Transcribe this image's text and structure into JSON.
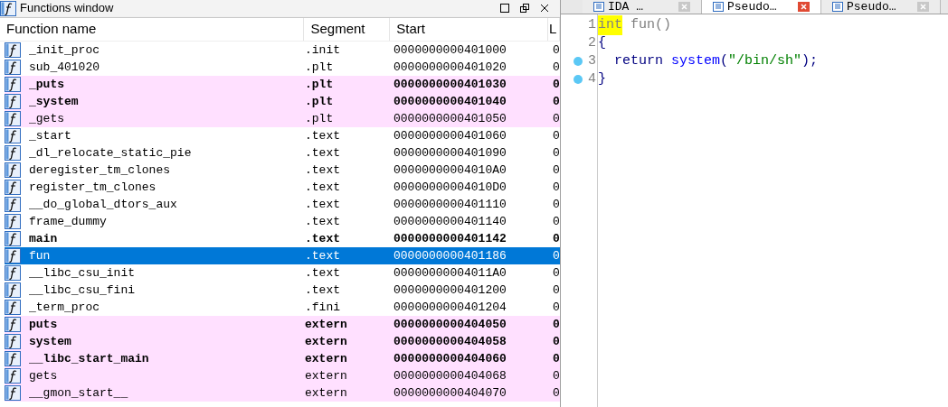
{
  "functions_window": {
    "title": "Functions window",
    "columns": [
      "Function name",
      "Segment",
      "Start",
      "L"
    ],
    "rows": [
      {
        "name": "_init_proc",
        "segment": ".init",
        "start": "0000000000401000",
        "column_4": "0",
        "bold": false,
        "highlighted": false,
        "selected": false
      },
      {
        "name": "sub_401020",
        "segment": ".plt",
        "start": "0000000000401020",
        "column_4": "0",
        "bold": false,
        "highlighted": false,
        "selected": false
      },
      {
        "name": "_puts",
        "segment": ".plt",
        "start": "0000000000401030",
        "column_4": "0",
        "bold": true,
        "highlighted": true,
        "selected": false
      },
      {
        "name": "_system",
        "segment": ".plt",
        "start": "0000000000401040",
        "column_4": "0",
        "bold": true,
        "highlighted": true,
        "selected": false
      },
      {
        "name": "_gets",
        "segment": ".plt",
        "start": "0000000000401050",
        "column_4": "0",
        "bold": false,
        "highlighted": true,
        "selected": false
      },
      {
        "name": "_start",
        "segment": ".text",
        "start": "0000000000401060",
        "column_4": "0",
        "bold": false,
        "highlighted": false,
        "selected": false
      },
      {
        "name": "_dl_relocate_static_pie",
        "segment": ".text",
        "start": "0000000000401090",
        "column_4": "0",
        "bold": false,
        "highlighted": false,
        "selected": false
      },
      {
        "name": "deregister_tm_clones",
        "segment": ".text",
        "start": "00000000004010A0",
        "column_4": "0",
        "bold": false,
        "highlighted": false,
        "selected": false
      },
      {
        "name": "register_tm_clones",
        "segment": ".text",
        "start": "00000000004010D0",
        "column_4": "0",
        "bold": false,
        "highlighted": false,
        "selected": false
      },
      {
        "name": "__do_global_dtors_aux",
        "segment": ".text",
        "start": "0000000000401110",
        "column_4": "0",
        "bold": false,
        "highlighted": false,
        "selected": false
      },
      {
        "name": "frame_dummy",
        "segment": ".text",
        "start": "0000000000401140",
        "column_4": "0",
        "bold": false,
        "highlighted": false,
        "selected": false
      },
      {
        "name": "main",
        "segment": ".text",
        "start": "0000000000401142",
        "column_4": "0",
        "bold": true,
        "highlighted": false,
        "selected": false
      },
      {
        "name": "fun",
        "segment": ".text",
        "start": "0000000000401186",
        "column_4": "0",
        "bold": false,
        "highlighted": false,
        "selected": true
      },
      {
        "name": "__libc_csu_init",
        "segment": ".text",
        "start": "00000000004011A0",
        "column_4": "0",
        "bold": false,
        "highlighted": false,
        "selected": false
      },
      {
        "name": "__libc_csu_fini",
        "segment": ".text",
        "start": "0000000000401200",
        "column_4": "0",
        "bold": false,
        "highlighted": false,
        "selected": false
      },
      {
        "name": "_term_proc",
        "segment": ".fini",
        "start": "0000000000401204",
        "column_4": "0",
        "bold": false,
        "highlighted": false,
        "selected": false
      },
      {
        "name": "puts",
        "segment": "extern",
        "start": "0000000000404050",
        "column_4": "0",
        "bold": true,
        "highlighted": true,
        "selected": false
      },
      {
        "name": "system",
        "segment": "extern",
        "start": "0000000000404058",
        "column_4": "0",
        "bold": true,
        "highlighted": true,
        "selected": false
      },
      {
        "name": "__libc_start_main",
        "segment": "extern",
        "start": "0000000000404060",
        "column_4": "0",
        "bold": true,
        "highlighted": true,
        "selected": false
      },
      {
        "name": "gets",
        "segment": "extern",
        "start": "0000000000404068",
        "column_4": "0",
        "bold": false,
        "highlighted": true,
        "selected": false
      },
      {
        "name": "__gmon_start__",
        "segment": "extern",
        "start": "0000000000404070",
        "column_4": "0",
        "bold": false,
        "highlighted": true,
        "selected": false
      }
    ]
  },
  "tabs": [
    {
      "label": "IDA …",
      "selected": false
    },
    {
      "label": "Pseudo…",
      "selected": true
    },
    {
      "label": "Pseudo…",
      "selected": false
    }
  ],
  "code": [
    {
      "number": "1",
      "breakpoint": false,
      "tokens": [
        {
          "kind": "keyword",
          "text": "int"
        },
        {
          "kind": "plain",
          "text": " fun()"
        }
      ]
    },
    {
      "number": "2",
      "breakpoint": false,
      "tokens": [
        {
          "kind": "punct",
          "text": "{"
        }
      ]
    },
    {
      "number": "3",
      "breakpoint": true,
      "tokens": [
        {
          "kind": "punct",
          "text": "  return "
        },
        {
          "kind": "call",
          "text": "system"
        },
        {
          "kind": "punct",
          "text": "("
        },
        {
          "kind": "string",
          "text": "\"/bin/sh\""
        },
        {
          "kind": "punct",
          "text": ");"
        }
      ]
    },
    {
      "number": "4",
      "breakpoint": true,
      "tokens": [
        {
          "kind": "punct",
          "text": "}"
        }
      ]
    }
  ]
}
